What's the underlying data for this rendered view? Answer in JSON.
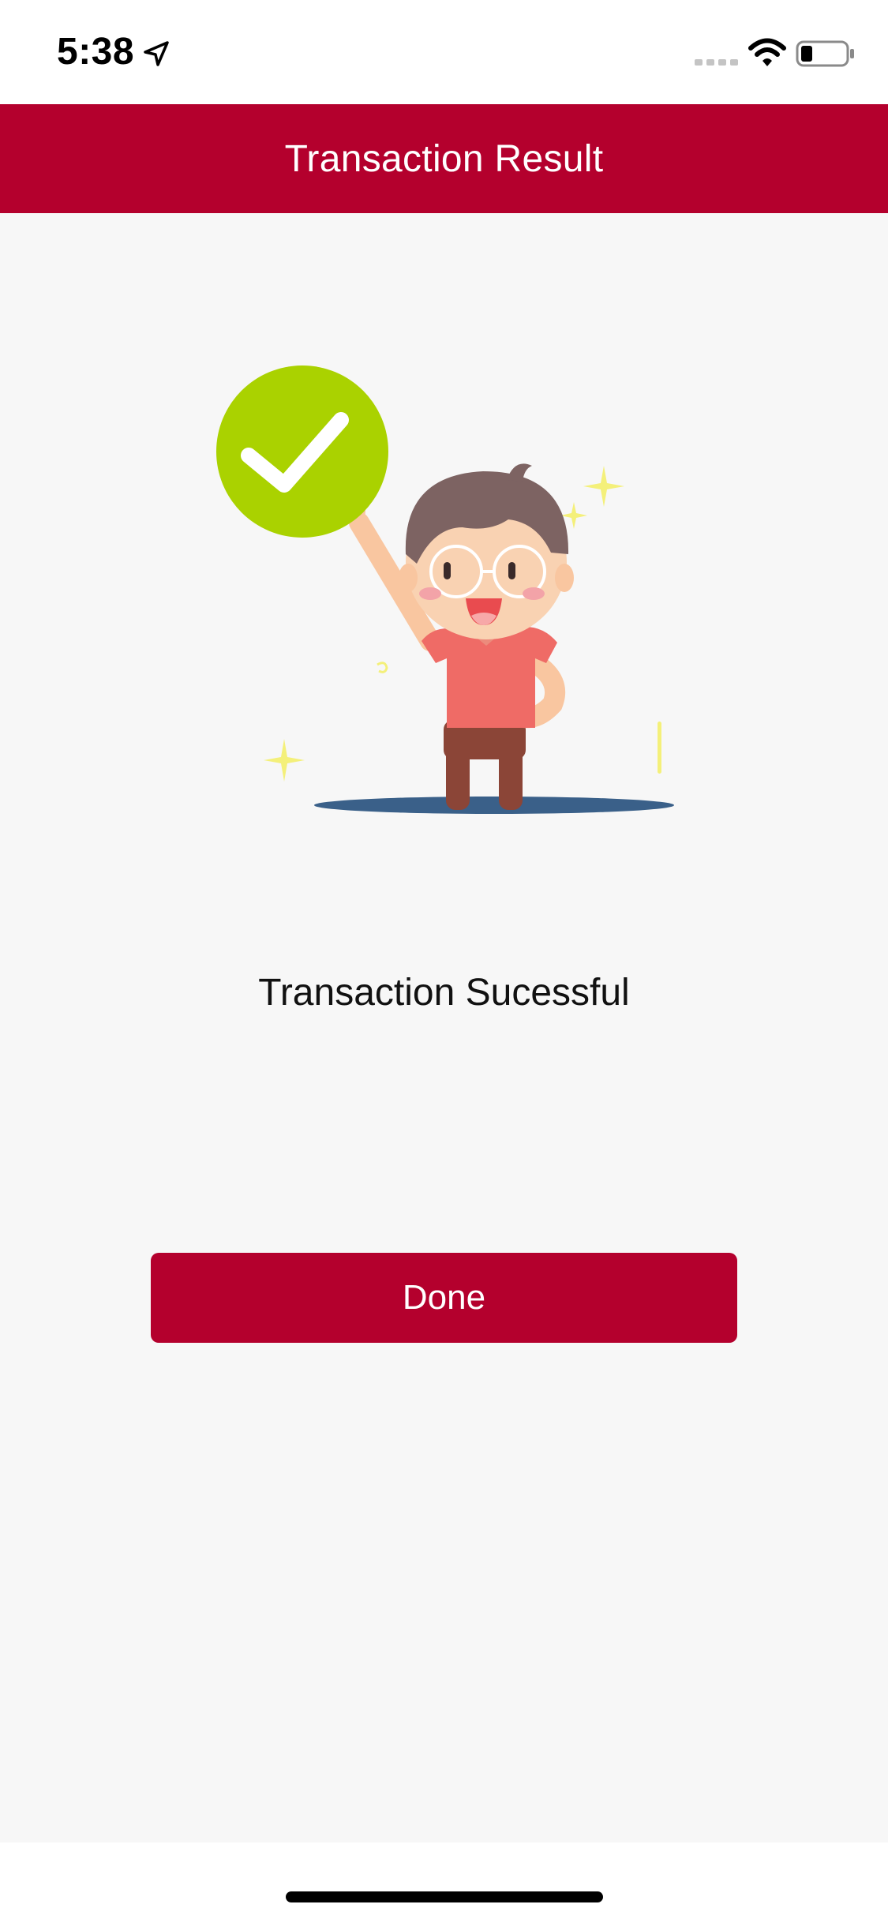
{
  "status_bar": {
    "time": "5:38",
    "location_icon": "location-arrow-icon",
    "signal_icon": "cellular-signal-icon",
    "wifi_icon": "wifi-icon",
    "battery_icon": "battery-icon"
  },
  "header": {
    "title": "Transaction Result",
    "background_color": "#b4002d"
  },
  "main": {
    "illustration_icon": "success-character-illustration",
    "check_icon": "checkmark-circle-icon",
    "message": "Transaction Sucessful",
    "accent_color": "#aad200"
  },
  "actions": {
    "done_label": "Done"
  },
  "colors": {
    "brand": "#b4002d",
    "background": "#f7f7f7"
  }
}
